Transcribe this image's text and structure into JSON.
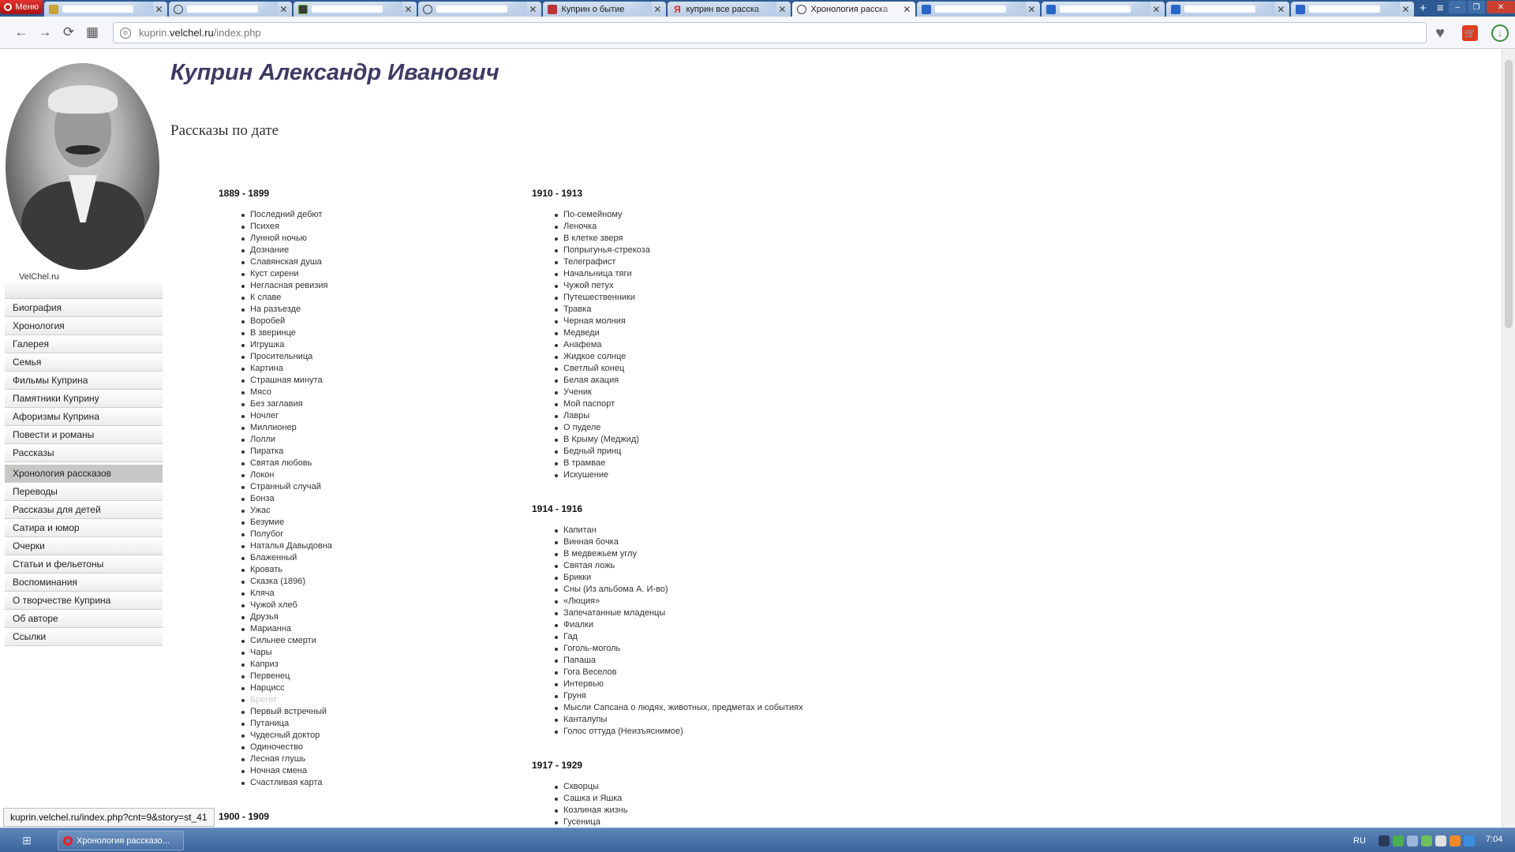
{
  "browser": {
    "menu_label": "Меню",
    "tabs": [
      {
        "title": "",
        "icon": "file-icon",
        "active": false
      },
      {
        "title": "",
        "icon": "globe-icon",
        "active": false
      },
      {
        "title": "",
        "icon": "tv-icon",
        "active": false
      },
      {
        "title": "",
        "icon": "globe-icon",
        "active": false
      },
      {
        "title": "Куприн о бытие",
        "icon": "site-icon",
        "active": false
      },
      {
        "title": "куприн все расска",
        "icon": "yandex-icon",
        "active": false
      },
      {
        "title": "Хронология расска",
        "icon": "globe-icon",
        "active": true
      },
      {
        "title": "",
        "icon": "doc-icon",
        "active": false
      },
      {
        "title": "",
        "icon": "doc-icon",
        "active": false
      },
      {
        "title": "",
        "icon": "doc-icon",
        "active": false
      },
      {
        "title": "",
        "icon": "doc-icon",
        "active": false
      }
    ],
    "address": {
      "prefix": "kuprin.",
      "domain": "velchel.ru",
      "path": "/index.php"
    },
    "status_url": "kuprin.velchel.ru/index.php?cnt=9&story=st_41"
  },
  "sidebar": {
    "site_name": "VelChel.ru",
    "menu_items": [
      {
        "label": "Биография",
        "active": false,
        "gap_after": false
      },
      {
        "label": "Хронология",
        "active": false,
        "gap_after": false
      },
      {
        "label": "Галерея",
        "active": false,
        "gap_after": false
      },
      {
        "label": "Семья",
        "active": false,
        "gap_after": false
      },
      {
        "label": "Фильмы Куприна",
        "active": false,
        "gap_after": false
      },
      {
        "label": "Памятники Куприну",
        "active": false,
        "gap_after": false
      },
      {
        "label": "Афоризмы Куприна",
        "active": false,
        "gap_after": false
      },
      {
        "label": "Повести и романы",
        "active": false,
        "gap_after": false
      },
      {
        "label": "Рассказы",
        "active": false,
        "gap_after": true
      },
      {
        "label": "Хронология рассказов",
        "active": true,
        "gap_after": false
      },
      {
        "label": "Переводы",
        "active": false,
        "gap_after": false
      },
      {
        "label": "Рассказы для детей",
        "active": false,
        "gap_after": false
      },
      {
        "label": "Сатира и юмор",
        "active": false,
        "gap_after": false
      },
      {
        "label": "Очерки",
        "active": false,
        "gap_after": false
      },
      {
        "label": "Статьи и фельетоны",
        "active": false,
        "gap_after": false
      },
      {
        "label": "Воспоминания",
        "active": false,
        "gap_after": false
      },
      {
        "label": "О творчестве Куприна",
        "active": false,
        "gap_after": false
      },
      {
        "label": "Об авторе",
        "active": false,
        "gap_after": false
      },
      {
        "label": "Ссылки",
        "active": false,
        "gap_after": false
      }
    ]
  },
  "main": {
    "title": "Куприн Александр Иванович",
    "subtitle": "Рассказы по дате",
    "columns": [
      {
        "sections": [
          {
            "period": "1889 - 1899",
            "stories": [
              "Последний дебют",
              "Психея",
              "Лунной ночью",
              "Дознание",
              "Славянская душа",
              "Куст сирени",
              "Негласная ревизия",
              "К славе",
              "На разъезде",
              "Воробей",
              "В зверинце",
              "Игрушка",
              "Просительница",
              "Картина",
              "Страшная минута",
              "Мясо",
              "Без заглавия",
              "Ночлег",
              "Миллионер",
              "Лолли",
              "Пиратка",
              "Святая любовь",
              "Локон",
              "Странный случай",
              "Бонза",
              "Ужас",
              "Безумие",
              "Полубог",
              "Наталья Давыдовна",
              "Блаженный",
              "Кровать",
              "Сказка (1896)",
              "Кляча",
              "Чужой хлеб",
              "Друзья",
              "Марианна",
              "Сильнее смерти",
              "Чары",
              "Каприз",
              "Первенец",
              "Нарцисс",
              "Брегет",
              "Первый встречный",
              "Путаница",
              "Чудесный доктор",
              "Одиночество",
              "Лесная глушь",
              "Ночная смена",
              "Счастливая карта"
            ],
            "visited_index": 41
          },
          {
            "period": "1900 - 1909",
            "stories": [],
            "visited_index": -1
          }
        ]
      },
      {
        "sections": [
          {
            "period": "1910 - 1913",
            "stories": [
              "По-семейному",
              "Леночка",
              "В клетке зверя",
              "Попрыгунья-стрекоза",
              "Телеграфист",
              "Начальница тяги",
              "Чужой петух",
              "Путешественники",
              "Травка",
              "Черная молния",
              "Медведи",
              "Анафема",
              "Жидкое солнце",
              "Светлый конец",
              "Белая акация",
              "Ученик",
              "Мой паспорт",
              "Лавры",
              "О пуделе",
              "В Крыму (Меджид)",
              "Бедный принц",
              "В трамвае",
              "Искушение"
            ],
            "visited_index": -1
          },
          {
            "period": "1914 - 1916",
            "stories": [
              "Капитан",
              "Винная бочка",
              "В медвежьем углу",
              "Святая ложь",
              "Брикки",
              "Сны (Из альбома А. И-во)",
              "«Люция»",
              "Запечатанные младенцы",
              "Фиалки",
              "Гад",
              "Гоголь-моголь",
              "Папаша",
              "Гога Веселов",
              "Интервью",
              "Груня",
              "Мысли Сапсана о людях, животных, предметах и событиях",
              "Канталупы",
              "Голос оттуда (Неизъяснимое)"
            ],
            "visited_index": -1
          },
          {
            "period": "1917 - 1929",
            "stories": [
              "Скворцы",
              "Сашка и Яшка",
              "Козлиная жизнь",
              "Гусеница"
            ],
            "visited_index": -1
          }
        ]
      }
    ]
  },
  "taskbar": {
    "task_label": "Хронология рассказо...",
    "language": "RU",
    "clock": "7:04"
  }
}
